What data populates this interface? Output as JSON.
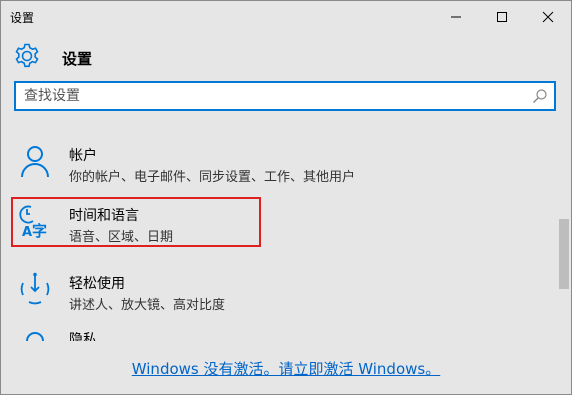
{
  "window": {
    "title": "设置"
  },
  "header": {
    "title": "设置"
  },
  "search": {
    "placeholder": "查找设置"
  },
  "items": [
    {
      "name": "帐户",
      "desc": "你的帐户、电子邮件、同步设置、工作、其他用户"
    },
    {
      "name": "时间和语言",
      "desc": "语音、区域、日期"
    },
    {
      "name": "轻松使用",
      "desc": "讲述人、放大镜、高对比度"
    },
    {
      "name": "隐私",
      "desc": ""
    }
  ],
  "footer": {
    "activation": "Windows 没有激活。请立即激活 Windows。"
  },
  "colors": {
    "accent": "#0078d7",
    "highlight_border": "#e02020",
    "link": "#0064c8"
  }
}
